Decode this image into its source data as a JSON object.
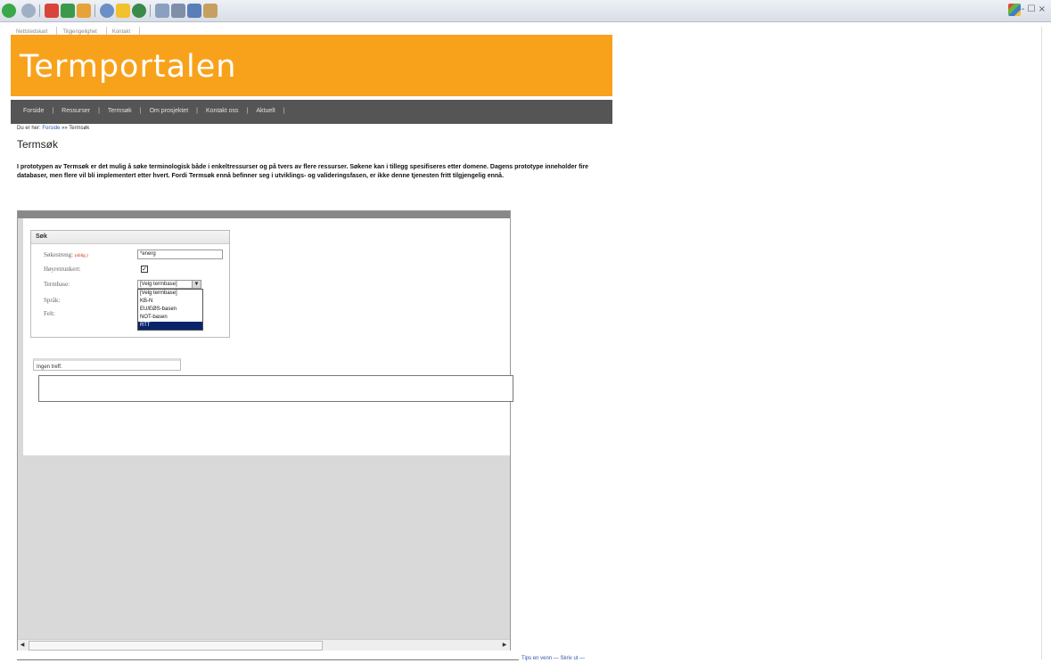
{
  "browser": {
    "window_controls": "- ☐ ×"
  },
  "utility_links": [
    "Nettstedskart",
    "Tilgjengelighet",
    "Kontakt"
  ],
  "site": {
    "title": "Termportalen",
    "brand_color": "#f8a21c"
  },
  "nav": [
    "Forside",
    "Ressurser",
    "Termsøk",
    "Om prosjektet",
    "Kontakt oss",
    "Aktuelt"
  ],
  "breadcrumb": {
    "prefix": "Du er her:",
    "link": "Forside",
    "arrow": "»»",
    "current": "Termsøk"
  },
  "page": {
    "title": "Termsøk",
    "intro": "I prototypen av Termsøk er det mulig å søke terminologisk både i enkeltressurser og på tvers av flere ressurser. Søkene kan i tillegg spesifiseres etter domene. Dagens prototype inneholder fire databaser, men flere vil bli implementert etter hvert. Fordi Termsøk ennå befinner seg i utviklings- og valideringsfasen, er ikke denne tjenesten fritt tilgjengelig ennå."
  },
  "search": {
    "legend": "Søk",
    "term_label": "Søkestreng:",
    "required": "(oblig.)",
    "term_value": "*energ",
    "trunc_label": "Høyretrunkert:",
    "trunc_checked": "✓",
    "termbase_label": "Termbase:",
    "termbase_selected": "[Velg termbase]",
    "termbase_options": [
      "[Velg termbase]",
      "KB-N",
      "EU/EØS-basen",
      "NOT-basen",
      "RTT"
    ],
    "highlighted_option": "RTT",
    "language_label": "Språk:",
    "field_label": "Felt:"
  },
  "results": {
    "status": "Ingen treff."
  },
  "footer": {
    "links": "Tips en venn — Skriv ut —"
  }
}
